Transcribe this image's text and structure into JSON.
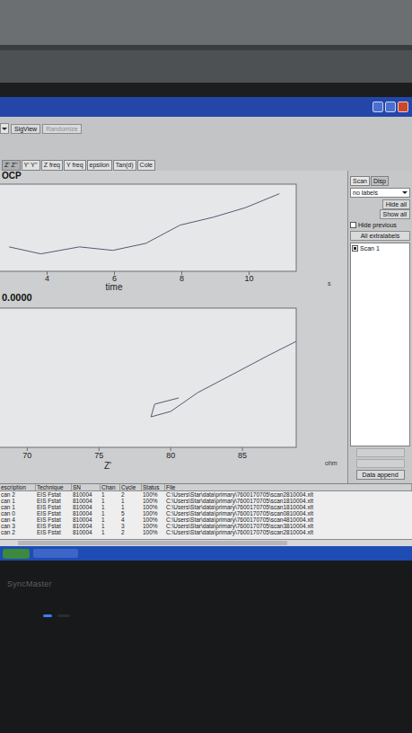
{
  "toolbar": {
    "buttons": [
      {
        "label": "SigView",
        "disabled": false
      },
      {
        "label": "Randomize",
        "disabled": true
      }
    ]
  },
  "tabs": [
    {
      "label": "Z' Z''",
      "selected": true
    },
    {
      "label": "Y' Y''",
      "selected": false
    },
    {
      "label": "Z freq",
      "selected": false
    },
    {
      "label": "Y freq",
      "selected": false
    },
    {
      "label": "epsilon",
      "selected": false
    },
    {
      "label": "Tan(d)",
      "selected": false
    },
    {
      "label": "Cole",
      "selected": false
    }
  ],
  "charts": [
    {
      "title": "OCP",
      "x_label": "time",
      "x_unit": "s",
      "x_ticks": [
        "4",
        "6",
        "8",
        "10"
      ],
      "series": [
        {
          "x": [
            2.87,
            3.81,
            4.96,
            5.95,
            6.93,
            7.95,
            8.93,
            9.89,
            10.9
          ],
          "y": [
            0.28,
            0.2,
            0.28,
            0.24,
            0.32,
            0.53,
            0.62,
            0.73,
            0.89
          ]
        }
      ]
    },
    {
      "title": "0.0000",
      "x_label": "Z'",
      "x_unit": "ohm",
      "x_ticks": [
        "70",
        "75",
        "80",
        "85"
      ],
      "series": [
        {
          "x": [
            80.56,
            78.88,
            78.63,
            80.0,
            81.9,
            84.4,
            86.9,
            88.75
          ],
          "y": [
            3.55,
            3.1,
            2.19,
            2.58,
            3.94,
            5.29,
            6.65,
            7.61
          ]
        }
      ]
    }
  ],
  "side_panel": {
    "tabs": [
      {
        "label": "Scan",
        "selected": true
      },
      {
        "label": "Disp",
        "selected": false
      }
    ],
    "dropdown": "no labels",
    "buttons": [
      "Hide all",
      "Show all"
    ],
    "hide_previous": {
      "label": "Hide previous",
      "checked": false
    },
    "extralabels": "All extralabels",
    "scans": [
      {
        "label": "Scan 1",
        "checked": true
      }
    ],
    "action_buttons": [
      {
        "label": "",
        "disabled": true
      },
      {
        "label": "",
        "disabled": true
      },
      {
        "label": "Data append",
        "disabled": false
      }
    ]
  },
  "table": {
    "columns": [
      "escription",
      "Technique",
      "SN",
      "Chan",
      "Cycle",
      "Status",
      "File"
    ],
    "rows": [
      [
        "can 2",
        "EIS Fstat",
        "810004",
        "1",
        "2",
        "100%",
        "C:\\Users\\Star\\data\\primary\\7600170705\\scan2810004.xlt"
      ],
      [
        "can 1",
        "EIS Fstat",
        "810004",
        "1",
        "1",
        "100%",
        "C:\\Users\\Star\\data\\primary\\7600170705\\scan1810004.xlt"
      ],
      [
        "can 1",
        "EIS Fstat",
        "810004",
        "1",
        "1",
        "100%",
        "C:\\Users\\Star\\data\\primary\\7600170705\\scan1810004.xlt"
      ],
      [
        "can 0",
        "EIS Fstat",
        "810004",
        "1",
        "5",
        "100%",
        "C:\\Users\\Star\\data\\primary\\7600170705\\scan0810004.xlt"
      ],
      [
        "can 4",
        "EIS Fstat",
        "810004",
        "1",
        "4",
        "100%",
        "C:\\Users\\Star\\data\\primary\\7600170705\\scan4810004.xlt"
      ],
      [
        "can 3",
        "EIS Fstat",
        "810004",
        "1",
        "3",
        "100%",
        "C:\\Users\\Star\\data\\primary\\7600170705\\scan3810004.xlt"
      ],
      [
        "can 2",
        "EIS Fstat",
        "810004",
        "1",
        "2",
        "100%",
        "C:\\Users\\Star\\data\\primary\\7600170705\\scan2810004.xlt"
      ]
    ]
  },
  "bezel": {
    "brand": "SyncMaster"
  }
}
